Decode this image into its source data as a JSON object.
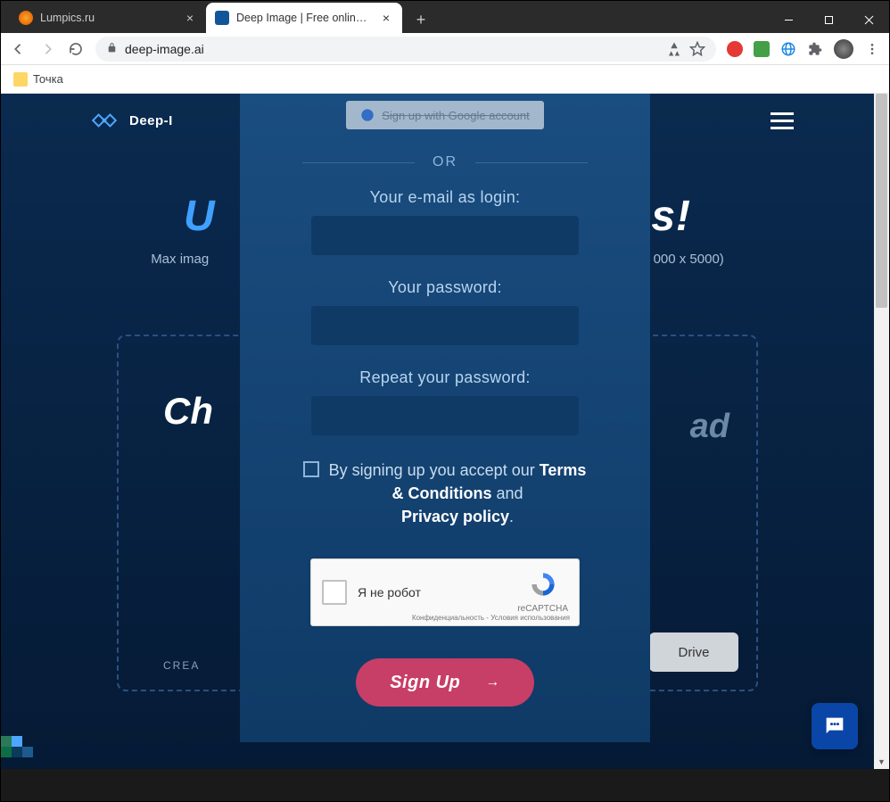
{
  "titlebar": {
    "min": "–",
    "max": "☐",
    "close": "✕"
  },
  "tabs": [
    {
      "title": "Lumpics.ru",
      "active": false
    },
    {
      "title": "Deep Image | Free online upscale",
      "active": true
    }
  ],
  "address_bar": {
    "url": "deep-image.ai"
  },
  "bookmarks": {
    "item1": "Точка"
  },
  "site": {
    "logo_text": "Deep-I",
    "hero_title_left": "U",
    "hero_title_right": "s!",
    "hero_sub_left": "Max imag",
    "hero_sub_right": "000 x 5000)",
    "dz_left": "Ch",
    "dz_right": "ad",
    "dz_crea": "CREA",
    "dz_drive": "Drive"
  },
  "signup": {
    "google": "Sign up with Google account",
    "or": "OR",
    "email_label": "Your e-mail as login:",
    "password_label": "Your password:",
    "repeat_label": "Repeat your password:",
    "accept_prefix": "By signing up you accept our ",
    "accept_terms": "Terms & Conditions",
    "accept_and": " and ",
    "accept_privacy": "Privacy policy",
    "accept_dot": ".",
    "captcha_label": "Я не робот",
    "captcha_brand": "reCAPTCHA",
    "captcha_links": "Конфиденциальность - Условия использования",
    "button": "Sign Up",
    "arrow": "→"
  }
}
